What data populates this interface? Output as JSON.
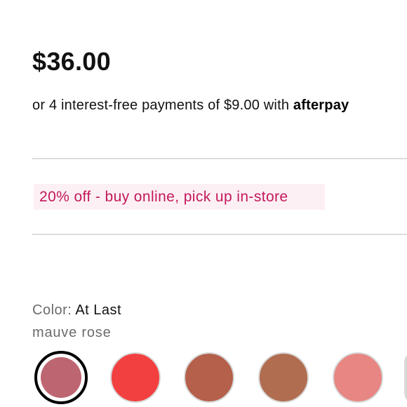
{
  "price": "$36.00",
  "installments": {
    "text": "or 4 interest-free payments of $9.00 with ",
    "brand": "afterpay"
  },
  "promo": {
    "text": "20% off - buy online, pick up in-store",
    "color": "#c2185b",
    "background": "#fdf0f4"
  },
  "color_selector": {
    "label": "Color:",
    "selected_name": "At Last",
    "selected_description": "mauve rose",
    "swatches": [
      {
        "color": "#bd6671",
        "selected": true
      },
      {
        "color": "#f24040",
        "selected": false
      },
      {
        "color": "#b4604a",
        "selected": false
      },
      {
        "color": "#b06d4f",
        "selected": false
      },
      {
        "color": "#e78682",
        "selected": false
      },
      {
        "color": "#d8d8d8",
        "selected": false
      }
    ]
  }
}
